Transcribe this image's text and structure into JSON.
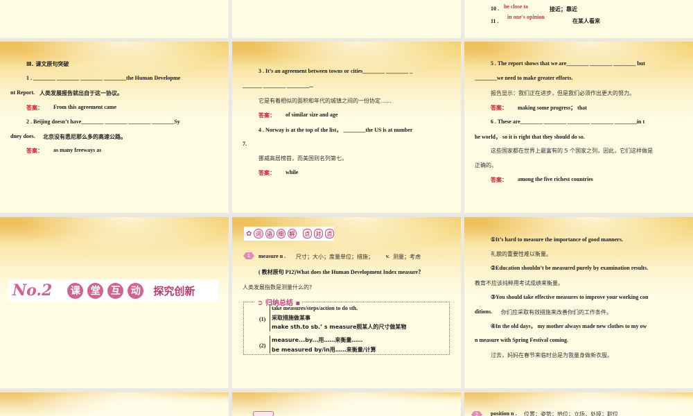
{
  "slides": [
    {
      "lines": [
        {
          "num": "10 .",
          "answer": "be close to",
          "zh": "接近；靠近"
        },
        {
          "num": "11 .",
          "answer": "in one's opinion",
          "zh": "在某人看来"
        }
      ]
    },
    {
      "heading": "Ⅲ. 课文原句突破",
      "q1a": "1 .  ________ ________ ________ ________the Human Developme",
      "q1b": "nt Report.",
      "q1zh": "人类发展报告就出自于这一协议。",
      "answer_label": "答案：",
      "a1": "From this agreement came",
      "q2a": "2 .  Beijing doesn’t have________ ________ ________ ________Sy",
      "q2b": "dney does.",
      "q2zh": "北京没有悉尼那么多的高速公路。",
      "a2": "as many freeways as"
    },
    {
      "q3a": "3 .  It’s an agreement between towns or cities________ ________ _",
      "q3b": "_______ ________ ________...",
      "q3zh": "它是有着相似的面积和年代的城镇之间的一份协定……",
      "answer_label": "答案：",
      "a3": "of similar size and age",
      "q4a": "4 .  Norway is at the top of the list，  ________the US is at number",
      "q4b": "7.",
      "q4zh": "挪威高居榜首，而美国则名列第七。",
      "a4": "while"
    },
    {
      "q5a": "5 .  The report shows that we are________ ________ ________ but",
      "q5b": "________we need to make greater efforts.",
      "q5zh": "报告显示：我们正在进步，但是我们必须作出更大的努力。",
      "answer_label": "答案：",
      "a5": "making some progress；  that",
      "q6a": "6 .  These are________ ________ ________ ________ ________in t",
      "q6b": "he world，  so it is right that they should do so.",
      "q6zh1": "这些国家都在世界上最富有的 5 个国家之列，因此，它们这样做是",
      "q6zh2": "正确的。",
      "a6": "among the five richest countries"
    },
    {
      "no": "No.2",
      "chars": [
        "课",
        "堂",
        "互",
        "动"
      ],
      "sub": "探究创新"
    },
    {
      "header_chars": [
        "词",
        "语",
        "细",
        "解"
      ],
      "header_tag": [
        "点",
        "对",
        "点"
      ],
      "item_num": "1",
      "word": "measure n .",
      "word_zh": "尺寸；大小；度量单位；措施；",
      "verb": "v.",
      "verb_zh": "测量；考虑",
      "src": "( 教材原句 P12)What does the Human Development Index measure？",
      "src_zh": "人类发展指数是测量什么的?",
      "summary_title": "归纳总结",
      "g1_label": "(1)",
      "g1": [
        "take measures/steps/action to do sth.",
        "采取措施做某事",
        "make sth.to sb.’ s measure照某人的尺寸做某物"
      ],
      "g2_label": "(2)",
      "g2": [
        "measure...by...用……来衡量……",
        "be measured by/in用……来衡量/计算"
      ]
    },
    {
      "examples": [
        {
          "en": "①It’s hard to measure the importance of good manners.",
          "zh": "礼貌的重要性难以衡量。"
        },
        {
          "en": "②Education shouldn’t be measured purely by examination results.",
          "zh": "教育不应该纯粹用考试成绩来衡量。"
        },
        {
          "en1": "③You should take effective measures to improve your working con",
          "en2": "ditions.",
          "zh": "你们应采取有效措施来改善你们的工作条件。"
        },
        {
          "en1": "④In the old days，  my mother always made new clothes to my ow",
          "en2": "n measure with Spring Festival coming.",
          "zh": "过去，妈妈在春节来临时总是为我量身做新衣服。"
        }
      ]
    },
    {
      "item_num": "2",
      "word": "position n .",
      "word_zh": "位置；姿势；地位；立场，处境；职位"
    }
  ]
}
